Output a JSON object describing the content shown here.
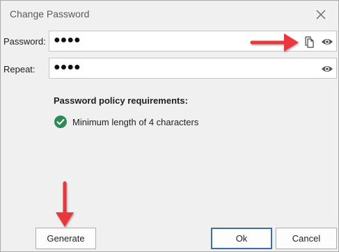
{
  "dialog": {
    "title": "Change Password",
    "close_icon": "close-icon"
  },
  "password": {
    "label": "Password:",
    "value": "●●●●",
    "copy_icon": "copy-icon",
    "reveal_icon": "eye-icon"
  },
  "repeat": {
    "label": "Repeat:",
    "value": "●●●●",
    "reveal_icon": "eye-icon"
  },
  "policy": {
    "title": "Password policy requirements:",
    "items": [
      {
        "text": "Minimum length of 4 characters",
        "status": "satisfied",
        "icon": "check-circle-icon"
      }
    ]
  },
  "buttons": {
    "generate": "Generate",
    "ok": "Ok",
    "cancel": "Cancel"
  },
  "annotations": {
    "arrow_color": "#e8383d",
    "arrows": [
      "arrow-to-copy-icon",
      "arrow-to-generate-button"
    ]
  },
  "colors": {
    "accent": "#3c6ea8",
    "success": "#2e8b57",
    "dialog_bg": "#f0f0f0"
  }
}
